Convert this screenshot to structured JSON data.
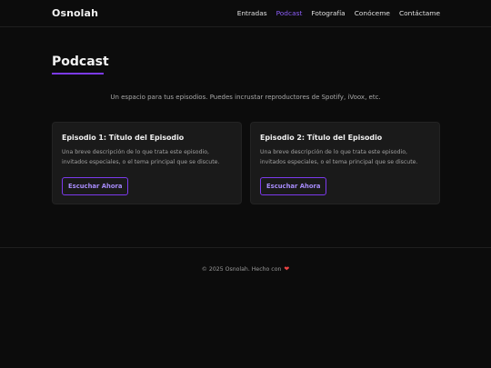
{
  "header": {
    "brand": "Osnolah",
    "nav": [
      {
        "label": "Entradas",
        "active": false
      },
      {
        "label": "Podcast",
        "active": true
      },
      {
        "label": "Fotografía",
        "active": false
      },
      {
        "label": "Conóceme",
        "active": false
      },
      {
        "label": "Contáctame",
        "active": false
      }
    ]
  },
  "main": {
    "title": "Podcast",
    "intro": "Un espacio para tus episodios. Puedes incrustar reproductores de Spotify, iVoox, etc.",
    "episodes": [
      {
        "title": "Episodio 1: Título del Episodio",
        "description": "Una breve descripción de lo que trata este episodio, invitados especiales, o el tema principal que se discute.",
        "button_label": "Escuchar Ahora"
      },
      {
        "title": "Episodio 2: Título del Episodio",
        "description": "Una breve descripción de lo que trata este episodio, invitados especiales, o el tema principal que se discute.",
        "button_label": "Escuchar Ahora"
      }
    ]
  },
  "footer": {
    "text": "© 2025 Osnolah. Hecho con",
    "icon": "heart-icon"
  },
  "colors": {
    "accent": "#8b5cf6",
    "background": "#0c0c0c",
    "card": "#1a1a1a",
    "heart": "#ef4444"
  }
}
